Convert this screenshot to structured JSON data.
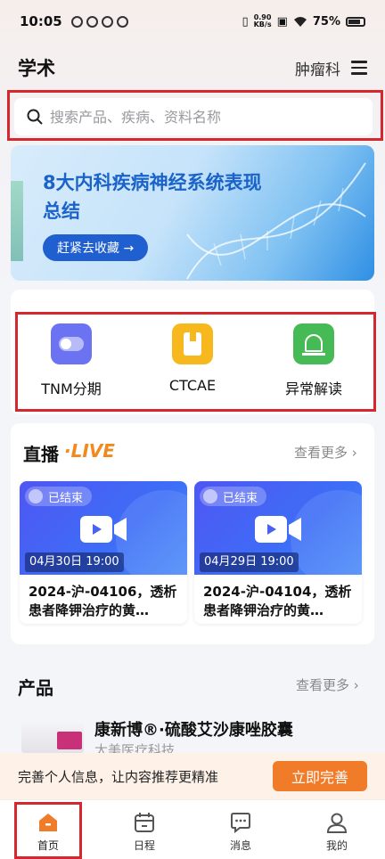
{
  "status_bar": {
    "time": "10:05",
    "net_speed_value": "0.90",
    "net_speed_unit": "KB/s",
    "battery": "75%"
  },
  "header": {
    "title": "学术",
    "department": "肿瘤科"
  },
  "search": {
    "placeholder": "搜索产品、疾病、资料名称"
  },
  "banner": {
    "title": "8大内科疾病神经系统表现总结",
    "button_label": "赶紧去收藏 →"
  },
  "tools": [
    {
      "label": "TNM分期",
      "icon": "toggle-icon",
      "color": "#6b73f2"
    },
    {
      "label": "CTCAE",
      "icon": "book-icon",
      "color": "#f7b81e"
    },
    {
      "label": "异常解读",
      "icon": "alarm-icon",
      "color": "#46bb55"
    }
  ],
  "live": {
    "title": "直播",
    "tag": "·LIVE",
    "more": "查看更多 ›",
    "items": [
      {
        "status": "已结束",
        "date": "04月30日 19:00",
        "name": "2024-沪-04106，透析患者降钾治疗的黄…"
      },
      {
        "status": "已结束",
        "date": "04月29日 19:00",
        "name": "2024-沪-04104，透析患者降钾治疗的黄…"
      }
    ]
  },
  "products": {
    "title": "产品",
    "more": "查看更多 ›",
    "items": [
      {
        "name": "康新博®·硫酸艾沙康唑胶囊",
        "company": "太美医疗科技"
      }
    ]
  },
  "prompt": {
    "text": "完善个人信息，让内容推荐更精准",
    "button": "立即完善"
  },
  "tabs": [
    {
      "label": "首页",
      "icon": "home-icon"
    },
    {
      "label": "日程",
      "icon": "calendar-icon"
    },
    {
      "label": "消息",
      "icon": "message-icon"
    },
    {
      "label": "我的",
      "icon": "user-icon"
    }
  ],
  "colors": {
    "accent_orange": "#f07b29",
    "highlight_frame": "#d6262e",
    "banner_blue": "#1f5fd0"
  }
}
